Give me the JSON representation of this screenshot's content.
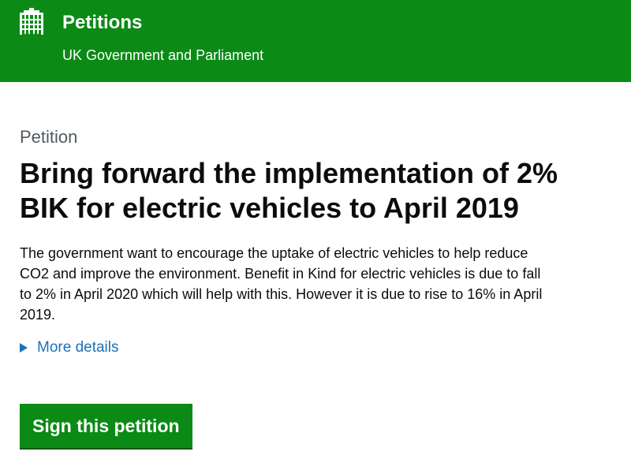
{
  "header": {
    "brand": "Petitions",
    "subtitle": "UK Government and Parliament",
    "logo_icon": "portcullis-icon",
    "background_color": "#0b8a16"
  },
  "petition": {
    "kicker": "Petition",
    "title": "Bring forward the implementation of 2% BIK for electric vehicles to April 2019",
    "description": "The government want to encourage the uptake of electric vehicles to help reduce CO2 and improve the environment. Benefit in Kind for electric vehicles is due to fall to 2% in April 2020 which will help with this. However it is due to rise to 16% in April 2019.",
    "more_details_label": "More details",
    "more_details_icon": "triangle-right-icon",
    "link_color": "#1d70b8"
  },
  "actions": {
    "sign_label": "Sign this petition",
    "button_color": "#0b8a16"
  }
}
